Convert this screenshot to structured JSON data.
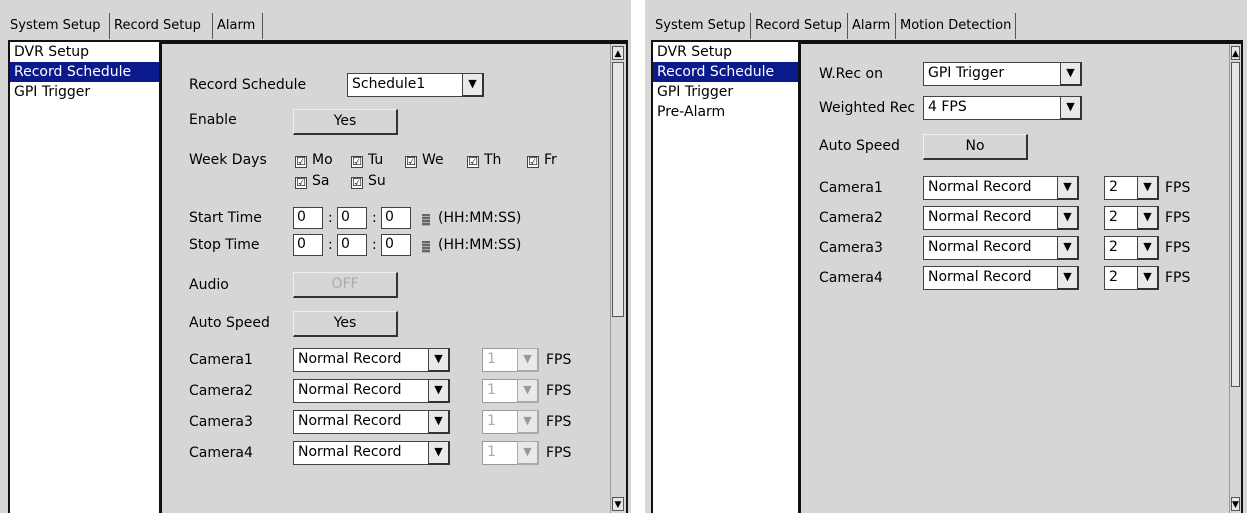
{
  "left": {
    "tabs": [
      "System Setup",
      "Record Setup",
      "Alarm"
    ],
    "sidebar": [
      "DVR Setup",
      "Record Schedule",
      "GPI Trigger"
    ],
    "record_schedule_label": "Record Schedule",
    "record_schedule_value": "Schedule1",
    "enable_label": "Enable",
    "enable_value": "Yes",
    "week_days_label": "Week Days",
    "days": [
      "Mo",
      "Tu",
      "We",
      "Th",
      "Fr",
      "Sa",
      "Su"
    ],
    "check_mark": "☑",
    "start_time_label": "Start Time",
    "stop_time_label": "Stop Time",
    "start_time": [
      "0",
      "0",
      "0"
    ],
    "stop_time": [
      "0",
      "0",
      "0"
    ],
    "time_sep": ":",
    "time_format": "(HH:MM:SS)",
    "audio_label": "Audio",
    "audio_value": "OFF",
    "auto_speed_label": "Auto Speed",
    "auto_speed_value": "Yes",
    "cameras": [
      {
        "label": "Camera1",
        "mode": "Normal Record",
        "fps": "1"
      },
      {
        "label": "Camera2",
        "mode": "Normal Record",
        "fps": "1"
      },
      {
        "label": "Camera3",
        "mode": "Normal Record",
        "fps": "1"
      },
      {
        "label": "Camera4",
        "mode": "Normal Record",
        "fps": "1"
      }
    ],
    "fps_unit": "FPS"
  },
  "right": {
    "tabs": [
      "System Setup",
      "Record Setup",
      "Alarm",
      "Motion Detection"
    ],
    "sidebar": [
      "DVR Setup",
      "Record Schedule",
      "GPI Trigger",
      "Pre-Alarm"
    ],
    "wrec_label": "W.Rec on",
    "wrec_value": "GPI Trigger",
    "weighted_label": "Weighted Rec",
    "weighted_value": "4 FPS",
    "auto_speed_label": "Auto Speed",
    "auto_speed_value": "No",
    "cameras": [
      {
        "label": "Camera1",
        "mode": "Normal Record",
        "fps": "2"
      },
      {
        "label": "Camera2",
        "mode": "Normal Record",
        "fps": "2"
      },
      {
        "label": "Camera3",
        "mode": "Normal Record",
        "fps": "2"
      },
      {
        "label": "Camera4",
        "mode": "Normal Record",
        "fps": "2"
      }
    ],
    "fps_unit": "FPS"
  },
  "icons": {
    "dropdown": "▼",
    "scroll_up": "▲",
    "scroll_down": "▼"
  },
  "colors": {
    "selection": "#0a1a8c",
    "panel": "#d6d6d6"
  }
}
